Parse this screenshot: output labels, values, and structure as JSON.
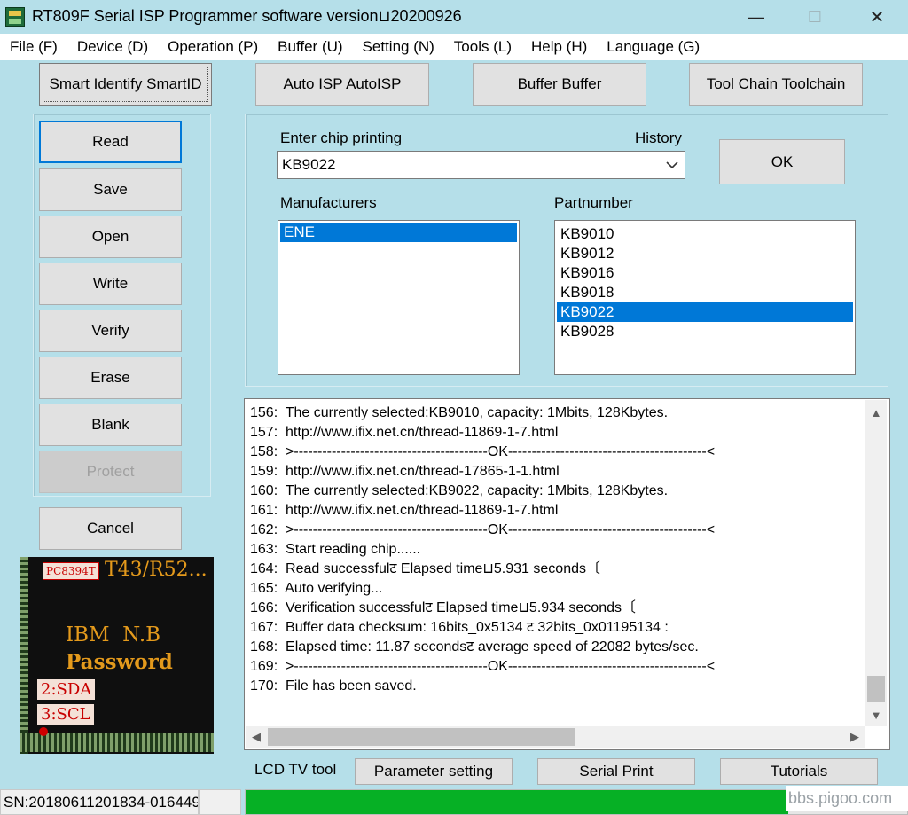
{
  "window": {
    "title": "RT809F Serial ISP Programmer software version└┨20200926",
    "title_display": "RT809F Serial ISP Programmer software version⊔20200926",
    "minimize": "—",
    "maximize": "☐",
    "close": "✕"
  },
  "menu": [
    "File (F)",
    "Device (D)",
    "Operation (P)",
    "Buffer (U)",
    "Setting (N)",
    "Tools (L)",
    "Help (H)",
    "Language (G)"
  ],
  "toolbar": {
    "smart_identify": "Smart Identify SmartID",
    "auto_isp": "Auto ISP AutoISP",
    "buffer": "Buffer Buffer",
    "tool_chain": "Tool Chain Toolchain"
  },
  "sidebar": {
    "read": "Read",
    "save": "Save",
    "open": "Open",
    "write": "Write",
    "verify": "Verify",
    "erase": "Erase",
    "blank": "Blank",
    "protect": "Protect",
    "cancel": "Cancel"
  },
  "chip_select": {
    "enter_label": "Enter chip printing",
    "history_label": "History",
    "value": "KB9022",
    "ok": "OK",
    "manufacturers_label": "Manufacturers",
    "partnumber_label": "Partnumber",
    "manufacturers": [
      "ENE"
    ],
    "manufacturer_selected": "ENE",
    "partnumbers": [
      "KB9010",
      "KB9012",
      "KB9016",
      "KB9018",
      "KB9022",
      "KB9028"
    ],
    "partnumber_selected": "KB9022"
  },
  "log": [
    "156:  The currently selected:KB9010, capacity: 1Mbits, 128Kbytes.",
    "157:  http://www.ifix.net.cn/thread-11869-1-7.html",
    "158:  >-----------------------------------------OK------------------------------------------<",
    "159:  http://www.ifix.net.cn/thread-17865-1-1.html",
    "160:  The currently selected:KB9022, capacity: 1Mbits, 128Kbytes.",
    "161:  http://www.ifix.net.cn/thread-11869-1-7.html",
    "162:  >-----------------------------------------OK------------------------------------------<",
    "163:  Start reading chip......",
    "164:  Read successfulㄝ Elapsed time└┨5.931 seconds〔",
    "165:  Auto verifying...",
    "166:  Verification successfulㄝ Elapsed time└┨5.934 seconds〔",
    "167:  Buffer data checksum: 16bits_0x5134 ㄝ 32bits_0x01195134 :",
    "168:  Elapsed time: 11.87 secondsㄝ average speed of 22082 bytes/sec.",
    "169:  >-----------------------------------------OK------------------------------------------<",
    "170:  File has been saved."
  ],
  "log_display": [
    "156:  The currently selected:KB9010, capacity: 1Mbits, 128Kbytes.",
    "157:  http://www.ifix.net.cn/thread-11869-1-7.html",
    "158:  >-----------------------------------------OK------------------------------------------<",
    "159:  http://www.ifix.net.cn/thread-17865-1-1.html",
    "160:  The currently selected:KB9022, capacity: 1Mbits, 128Kbytes.",
    "161:  http://www.ifix.net.cn/thread-11869-1-7.html",
    "162:  >-----------------------------------------OK------------------------------------------<",
    "163:  Start reading chip......",
    "164:  Read successfulट Elapsed time⊔5.931 seconds〔",
    "165:  Auto verifying...",
    "166:  Verification successfulट Elapsed time⊔5.934 seconds〔",
    "167:  Buffer data checksum: 16bits_0x5134 ट 32bits_0x01195134 :",
    "168:  Elapsed time: 11.87 secondsट average speed of 22082 bytes/sec.",
    "169:  >-----------------------------------------OK------------------------------------------<",
    "170:  File has been saved."
  ],
  "chip_image": {
    "badge": "PC8394T",
    "model": "T43/R52...",
    "line1": "IBM  N.B",
    "line2": "Password",
    "pin2": "2:SDA",
    "pin3": "3:SCL"
  },
  "bottom": {
    "lcd_label": "LCD TV tool",
    "parameter_setting": "Parameter setting",
    "serial_print": "Serial Print",
    "tutorials": "Tutorials"
  },
  "status": {
    "sn": "SN:20180611201834-016449",
    "progress": 0.82,
    "watermark": "bbs.pigoo.com"
  },
  "icons": {
    "app": "app-icon",
    "dropdown": "chevron-down-icon",
    "scroll_up": "scroll-up-icon",
    "scroll_down": "scroll-down-icon",
    "scroll_left": "scroll-left-icon",
    "scroll_right": "scroll-right-icon"
  },
  "colors": {
    "window_bg": "#b5dfe9",
    "selection": "#0078d7",
    "progress": "#06b025"
  }
}
